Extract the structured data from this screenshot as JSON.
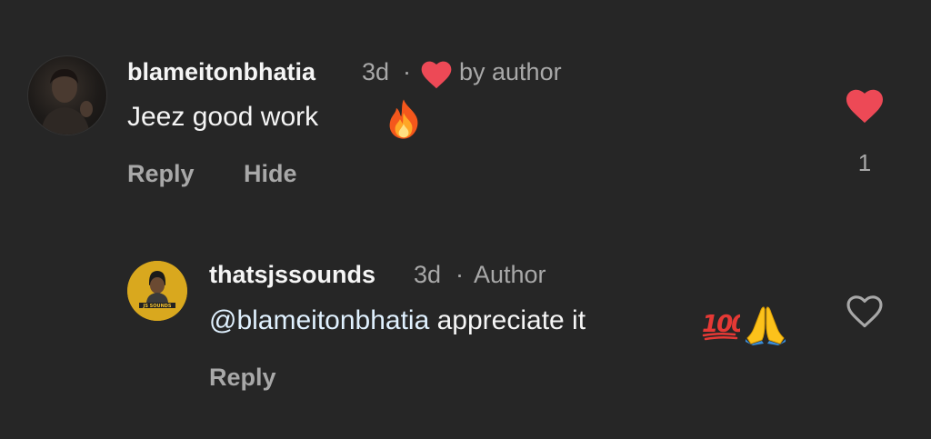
{
  "comments": [
    {
      "username": "blameitonbhatia",
      "time": "3d",
      "separator": "·",
      "liked_by_author_label": "by author",
      "text": "Jeez good work",
      "emoji": "fire",
      "reply_label": "Reply",
      "hide_label": "Hide",
      "like_count": "1",
      "liked": true
    }
  ],
  "replies": [
    {
      "username": "thatsjssounds",
      "time": "3d",
      "separator": "·",
      "author_label": "Author",
      "mention": "@blameitonbhatia",
      "text": " appreciate it",
      "emoji": [
        "hundred-points",
        "folded-hands"
      ],
      "avatar_text": "JS SOUNDS",
      "reply_label": "Reply",
      "liked": false
    }
  ],
  "colors": {
    "background": "#262626",
    "primary_text": "#f5f5f5",
    "secondary_text": "#a8a8a8",
    "like_red": "#ed4956",
    "mention": "#e0f1ff",
    "avatar_yellow": "#d9a81e"
  }
}
